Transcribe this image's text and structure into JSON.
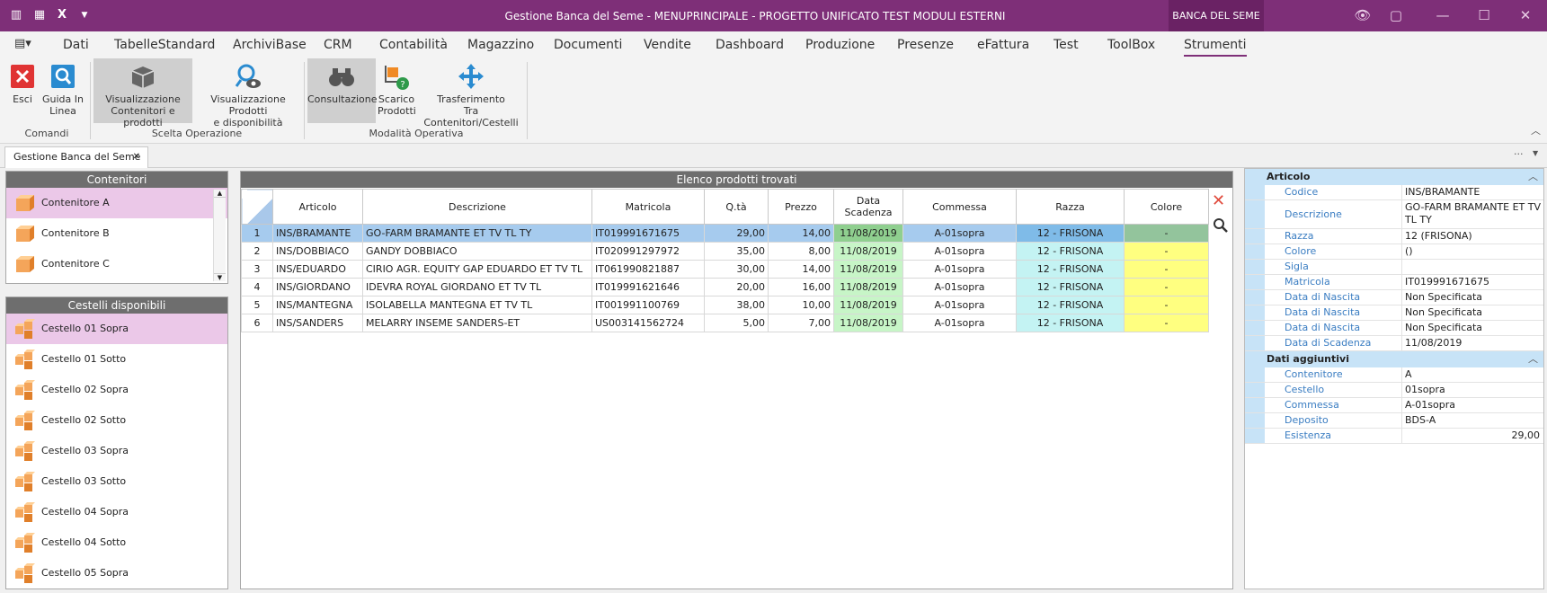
{
  "window": {
    "title": "Gestione Banca del Seme - MENUPRINCIPALE - PROGETTO UNIFICATO TEST MODULI ESTERNI",
    "app_label": "BANCA DEL SEME"
  },
  "menu": [
    "Dati",
    "TabelleStandard",
    "ArchiviBase",
    "CRM",
    "Contabilità",
    "Magazzino",
    "Documenti",
    "Vendite",
    "Dashboard",
    "Produzione",
    "Presenze",
    "eFattura",
    "Test",
    "ToolBox",
    "Strumenti"
  ],
  "ribbon": {
    "esci": "Esci",
    "guida_1": "Guida In",
    "guida_2": "Linea",
    "vis_cont_1": "Visualizzazione",
    "vis_cont_2": "Contenitori e prodotti",
    "vis_prod_1": "Visualizzazione Prodotti",
    "vis_prod_2": "e disponibilità",
    "consultazione": "Consultazione",
    "scarico_1": "Scarico",
    "scarico_2": "Prodotti",
    "trasf_1": "Trasferimento",
    "trasf_2": "Tra Contenitori/Cestelli",
    "group_comandi": "Comandi",
    "group_scelta": "Scelta Operazione",
    "group_modalita": "Modalità Operativa"
  },
  "doc_tab": "Gestione Banca del Seme",
  "contenitori": {
    "title": "Contenitori",
    "items": [
      "Contenitore A",
      "Contenitore B",
      "Contenitore C"
    ]
  },
  "cestelli": {
    "title": "Cestelli disponibili",
    "items": [
      "Cestello 01 Sopra",
      "Cestello 01 Sotto",
      "Cestello 02 Sopra",
      "Cestello 02 Sotto",
      "Cestello 03 Sopra",
      "Cestello 03 Sotto",
      "Cestello 04 Sopra",
      "Cestello 04 Sotto",
      "Cestello 05 Sopra"
    ]
  },
  "grid": {
    "title": "Elenco prodotti trovati",
    "headers": [
      "Articolo",
      "Descrizione",
      "Matricola",
      "Q.tà",
      "Prezzo",
      "Data Scadenza",
      "Commessa",
      "Razza",
      "Colore"
    ],
    "rows": [
      [
        "1",
        "INS/BRAMANTE",
        "GO-FARM BRAMANTE ET TV TL TY",
        "IT019991671675",
        "29,00",
        "14,00",
        "11/08/2019",
        "A-01sopra",
        "12 - FRISONA",
        "-"
      ],
      [
        "2",
        "INS/DOBBIACO",
        "GANDY DOBBIACO",
        "IT020991297972",
        "35,00",
        "8,00",
        "11/08/2019",
        "A-01sopra",
        "12 - FRISONA",
        "-"
      ],
      [
        "3",
        "INS/EDUARDO",
        "CIRIO AGR. EQUITY GAP EDUARDO ET TV TL",
        "IT061990821887",
        "30,00",
        "14,00",
        "11/08/2019",
        "A-01sopra",
        "12 - FRISONA",
        "-"
      ],
      [
        "4",
        "INS/GIORDANO",
        "IDEVRA ROYAL GIORDANO ET TV TL",
        "IT019991621646",
        "20,00",
        "16,00",
        "11/08/2019",
        "A-01sopra",
        "12 - FRISONA",
        "-"
      ],
      [
        "5",
        "INS/MANTEGNA",
        "ISOLABELLA MANTEGNA ET TV TL",
        "IT001991100769",
        "38,00",
        "10,00",
        "11/08/2019",
        "A-01sopra",
        "12 - FRISONA",
        "-"
      ],
      [
        "6",
        "INS/SANDERS",
        "MELARRY INSEME SANDERS-ET",
        "US003141562724",
        "5,00",
        "7,00",
        "11/08/2019",
        "A-01sopra",
        "12 - FRISONA",
        "-"
      ]
    ]
  },
  "details": {
    "sec1": "Articolo",
    "sec1_rows": [
      [
        "Codice",
        "INS/BRAMANTE"
      ],
      [
        "Descrizione",
        "GO-FARM BRAMANTE ET TV TL TY"
      ],
      [
        "Razza",
        "12 (FRISONA)"
      ],
      [
        "Colore",
        "()"
      ],
      [
        "Sigla",
        ""
      ],
      [
        "Matricola",
        "IT019991671675"
      ],
      [
        "Data di Nascita",
        "Non Specificata"
      ],
      [
        "Data di Nascita",
        "Non Specificata"
      ],
      [
        "Data di Nascita",
        "Non Specificata"
      ],
      [
        "Data di Scadenza",
        "11/08/2019"
      ]
    ],
    "sec2": "Dati aggiuntivi",
    "sec2_rows": [
      [
        "Contenitore",
        "A"
      ],
      [
        "Cestello",
        "01sopra"
      ],
      [
        "Commessa",
        "A-01sopra"
      ],
      [
        "Deposito",
        "BDS-A"
      ],
      [
        "Esistenza",
        "29,00"
      ]
    ]
  },
  "colors": {
    "title_bar": "#7e2f78",
    "selection": "#ebc8e8",
    "section": "#c7e3f7"
  }
}
